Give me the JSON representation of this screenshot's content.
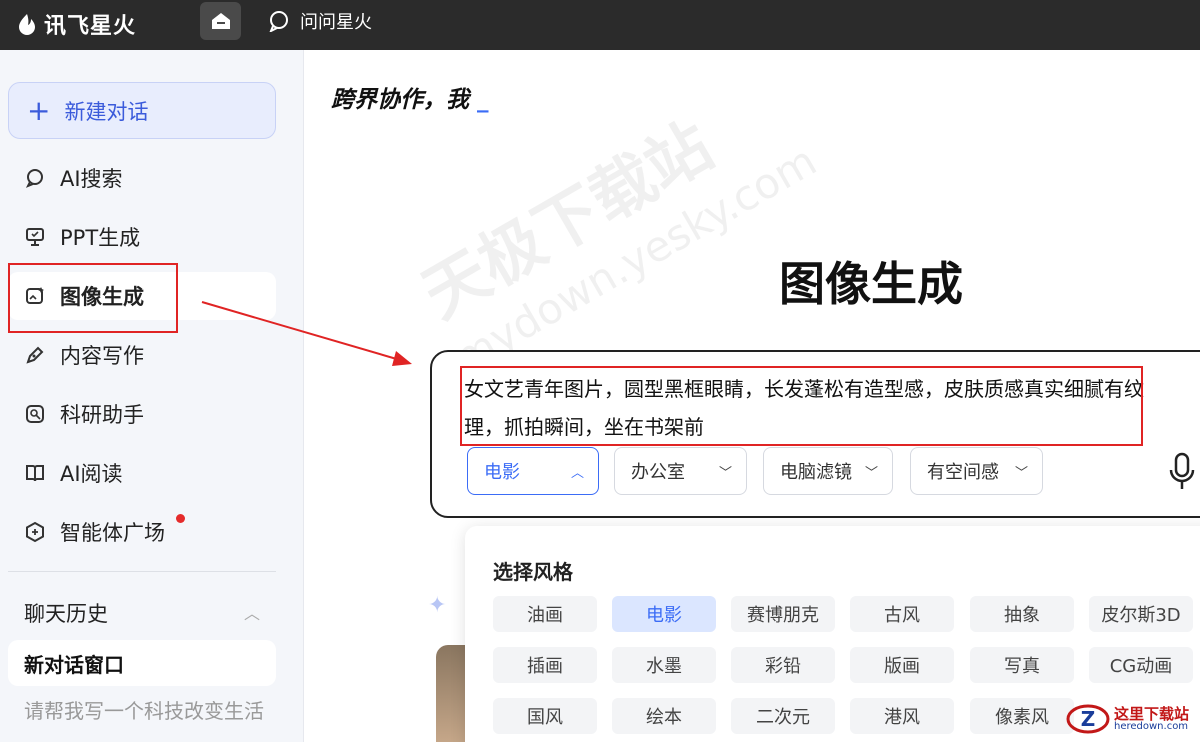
{
  "topbar": {
    "brand_name": "讯飞星火",
    "ask_label": "问问星火"
  },
  "sidebar": {
    "new_chat_label": "新建对话",
    "items": [
      {
        "label": "AI搜索",
        "icon": "search-chat-icon"
      },
      {
        "label": "PPT生成",
        "icon": "ppt-icon"
      },
      {
        "label": "图像生成",
        "icon": "image-gen-icon",
        "active": true
      },
      {
        "label": "内容写作",
        "icon": "pen-icon"
      },
      {
        "label": "科研助手",
        "icon": "research-icon"
      },
      {
        "label": "AI阅读",
        "icon": "book-icon"
      },
      {
        "label": "智能体广场",
        "icon": "agent-icon",
        "has_dot": true
      }
    ],
    "history_title": "聊天历史",
    "history_items": [
      "新对话窗口",
      "请帮我写一个科技改变生活"
    ]
  },
  "main": {
    "tagline": "跨界协作，我",
    "cursor": "_",
    "title": "图像生成",
    "watermark_cn": "天极下载站",
    "watermark_en": "mydown.yesky.com",
    "prompt_text": "女文艺青年图片，圆型黑框眼睛，长发蓬松有造型感，皮肤质感真实细腻有纹理，抓拍瞬间，坐在书架前",
    "chips": [
      "电影",
      "办公室",
      "电脑滤镜",
      "有空间感"
    ],
    "style_panel": {
      "title": "选择风格",
      "selected": "电影",
      "options": [
        [
          "油画",
          "电影",
          "赛博朋克",
          "古风",
          "抽象",
          "皮尔斯3D"
        ],
        [
          "插画",
          "水墨",
          "彩铅",
          "版画",
          "写真",
          "CG动画"
        ],
        [
          "国风",
          "绘本",
          "二次元",
          "港风",
          "像素风"
        ]
      ]
    }
  },
  "site_logo": {
    "cn": "这里下载站",
    "en": "heredown.com"
  },
  "colors": {
    "accent": "#3b6cf6",
    "annotation": "#e02424",
    "topbar": "#2b2b2b"
  }
}
